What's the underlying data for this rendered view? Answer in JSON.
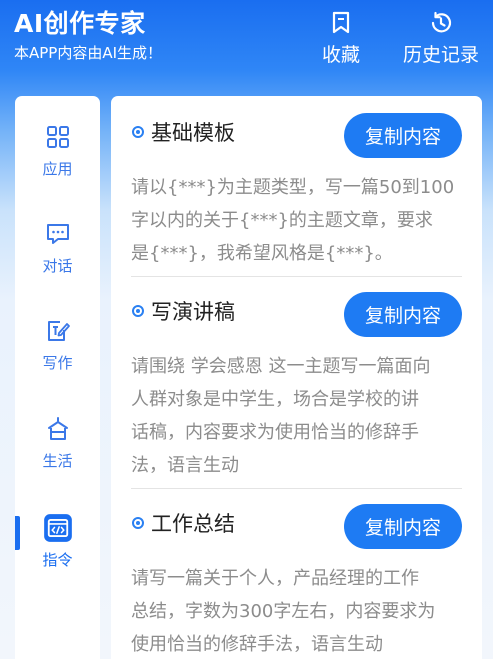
{
  "header": {
    "title": "AI创作专家",
    "subtitle": "本APP内容由AI生成！",
    "favorites_label": "收藏",
    "history_label": "历史记录"
  },
  "sidebar": {
    "items": [
      {
        "label": "应用",
        "icon": "grid-icon"
      },
      {
        "label": "对话",
        "icon": "chat-icon"
      },
      {
        "label": "写作",
        "icon": "write-icon"
      },
      {
        "label": "生活",
        "icon": "home-icon"
      },
      {
        "label": "指令",
        "icon": "code-icon",
        "active": true
      }
    ]
  },
  "sections": [
    {
      "title": "基础模板",
      "button": "复制内容",
      "lines": [
        "请以{***}为主题类型，写一篇50到100",
        "字以内的关于{***}的主题文章，要求",
        "是{***}，我希望风格是{***}。"
      ]
    },
    {
      "title": "写演讲稿",
      "button": "复制内容",
      "lines": [
        "请围绕 学会感恩 这一主题写一篇面向",
        "人群对象是中学生，场合是学校的讲",
        "话稿，内容要求为使用恰当的修辞手",
        "法，语言生动"
      ]
    },
    {
      "title": "工作总结",
      "button": "复制内容",
      "lines": [
        "请写一篇关于个人，产品经理的工作",
        "总结，字数为300字左右，内容要求为",
        "使用恰当的修辞手法，语言生动"
      ]
    }
  ],
  "colors": {
    "primary": "#1e7bf3",
    "nav_text": "#3b78e8",
    "desc_text": "#8c8c8c"
  }
}
